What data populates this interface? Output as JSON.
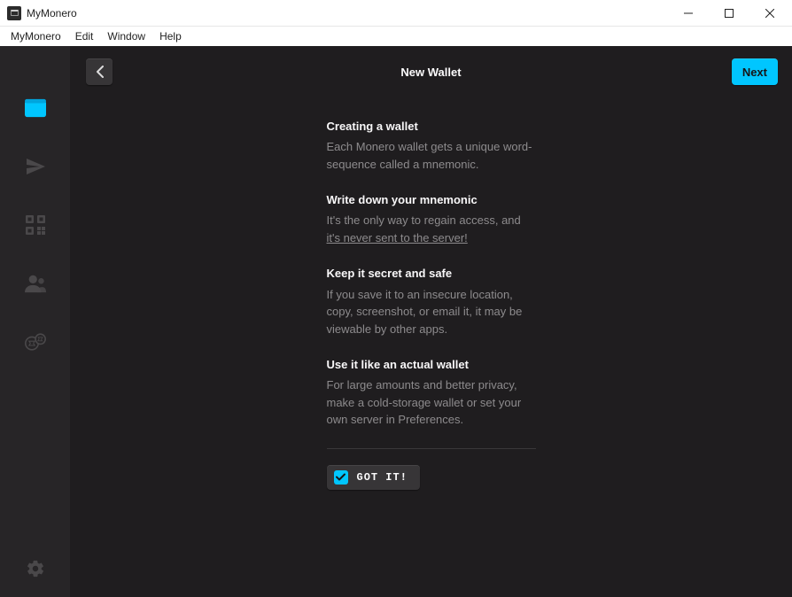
{
  "window": {
    "title": "MyMonero"
  },
  "menu": {
    "items": [
      "MyMonero",
      "Edit",
      "Window",
      "Help"
    ]
  },
  "topbar": {
    "title": "New Wallet",
    "next_label": "Next"
  },
  "info": {
    "blocks": [
      {
        "heading": "Creating a wallet",
        "text": "Each Monero wallet gets a unique word-sequence called a mnemonic."
      },
      {
        "heading": "Write down your mnemonic",
        "text_pre": "It's the only way to regain access, and ",
        "text_underline": "it's never sent to the server!"
      },
      {
        "heading": "Keep it secret and safe",
        "text": "If you save it to an insecure location, copy, screenshot, or email it, it may be viewable by other apps."
      },
      {
        "heading": "Use it like an actual wallet",
        "text": "For large amounts and better privacy, make a cold-storage wallet or set your own server in Preferences."
      }
    ],
    "got_it_label": "GOT IT!"
  },
  "sidebar": {
    "icons": [
      "wallet-icon",
      "send-icon",
      "qr-icon",
      "contacts-icon",
      "exchange-icon"
    ],
    "settings_icon": "settings-icon"
  }
}
